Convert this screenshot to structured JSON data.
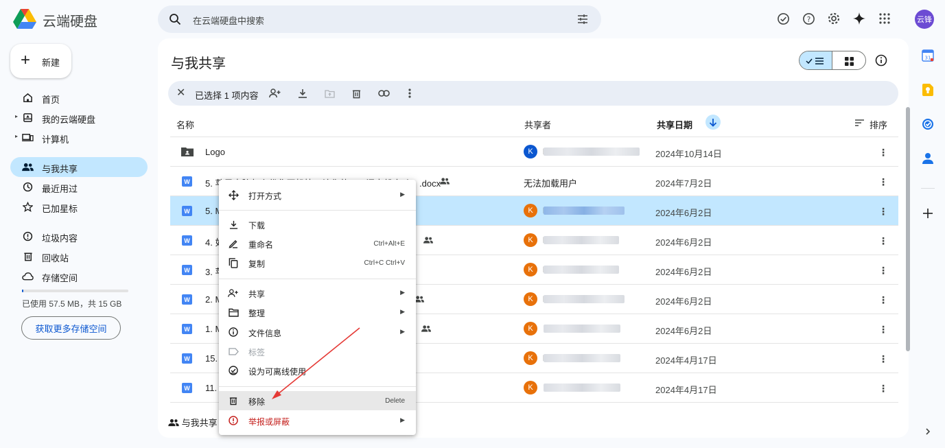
{
  "app": {
    "title": "云端硬盘",
    "search_placeholder": "在云端硬盘中搜索",
    "avatar_text": "云锋"
  },
  "sidebar": {
    "new_label": "新建",
    "items": [
      {
        "label": "首页",
        "icon": "home-icon"
      },
      {
        "label": "我的云端硬盘",
        "icon": "drive-icon"
      },
      {
        "label": "计算机",
        "icon": "computer-icon"
      },
      {
        "label": "与我共享",
        "icon": "people-icon",
        "active": true
      },
      {
        "label": "最近用过",
        "icon": "clock-icon"
      },
      {
        "label": "已加星标",
        "icon": "star-icon"
      },
      {
        "label": "垃圾内容",
        "icon": "spam-icon"
      },
      {
        "label": "回收站",
        "icon": "trash-icon"
      },
      {
        "label": "存储空间",
        "icon": "cloud-icon"
      }
    ],
    "storage_text": "已使用 57.5 MB，共 15 GB",
    "storage_fraction": 0.004,
    "more_storage_label": "获取更多存储空间"
  },
  "main": {
    "title": "与我共享",
    "selection_text": "已选择 1 项内容",
    "columns": {
      "name": "名称",
      "sharer": "共享者",
      "date": "共享日期",
      "sort": "排序"
    },
    "rows": [
      {
        "name": "Logo",
        "type": "folder",
        "sharer_initial": "K",
        "sharer_hint": "k",
        "date": "2024年10月14日",
        "avatar_color": "#0b57d0"
      },
      {
        "name": "5. 苹果电脑怎么优化开机快：让你的Mac闪电般启动！.docx",
        "type": "doc",
        "sharer_text": "无法加载用户",
        "date": "2024年7月2日",
        "shared": true
      },
      {
        "name": "5. M",
        "type": "doc",
        "sharer_initial": "K",
        "sharer_hint": "k",
        "date": "2024年6月2日",
        "selected": true,
        "avatar_color": "#e8710a"
      },
      {
        "name": "4. 如",
        "type": "doc",
        "sharer_initial": "K",
        "sharer_hint": "k",
        "date": "2024年6月2日",
        "shared": true,
        "avatar_color": "#e8710a"
      },
      {
        "name": "3. 苹",
        "type": "doc",
        "sharer_initial": "K",
        "sharer_hint": "k",
        "date": "2024年6月2日",
        "avatar_color": "#e8710a"
      },
      {
        "name": "2. M",
        "type": "doc",
        "sharer_initial": "K",
        "sharer_hint": "k",
        "date": "2024年6月2日",
        "shared": true,
        "avatar_color": "#e8710a"
      },
      {
        "name": "1. M",
        "type": "doc",
        "sharer_initial": "K",
        "sharer_hint": "",
        "date": "2024年6月2日",
        "shared": true,
        "avatar_color": "#e8710a"
      },
      {
        "name": "15.",
        "type": "doc",
        "sharer_initial": "K",
        "sharer_hint": "k",
        "date": "2024年4月17日",
        "avatar_color": "#e8710a"
      },
      {
        "name": "11.",
        "type": "doc",
        "sharer_initial": "K",
        "sharer_hint": "",
        "date": "2024年4月17日",
        "avatar_color": "#e8710a"
      }
    ],
    "bottom_label": "与我共享"
  },
  "context_menu": {
    "items": [
      {
        "label": "打开方式",
        "icon": "open-with-icon",
        "submenu": true
      },
      {
        "label": "下载",
        "icon": "download-icon"
      },
      {
        "label": "重命名",
        "icon": "rename-icon",
        "shortcut": "Ctrl+Alt+E"
      },
      {
        "label": "复制",
        "icon": "copy-icon",
        "shortcut": "Ctrl+C Ctrl+V"
      },
      {
        "label": "共享",
        "icon": "share-icon",
        "submenu": true
      },
      {
        "label": "整理",
        "icon": "organize-icon",
        "submenu": true
      },
      {
        "label": "文件信息",
        "icon": "info-icon",
        "submenu": true
      },
      {
        "label": "标签",
        "icon": "label-icon",
        "disabled": true
      },
      {
        "label": "设为可离线使用",
        "icon": "offline-icon"
      },
      {
        "label": "移除",
        "icon": "trash-icon",
        "shortcut": "Delete",
        "hover": true
      },
      {
        "label": "举报或屏蔽",
        "icon": "report-icon",
        "submenu": true,
        "danger": true
      }
    ]
  },
  "colors": {
    "accent": "#0b57d0",
    "selected": "#c2e7ff",
    "danger": "#c5221f",
    "annotation": "#e53935"
  }
}
